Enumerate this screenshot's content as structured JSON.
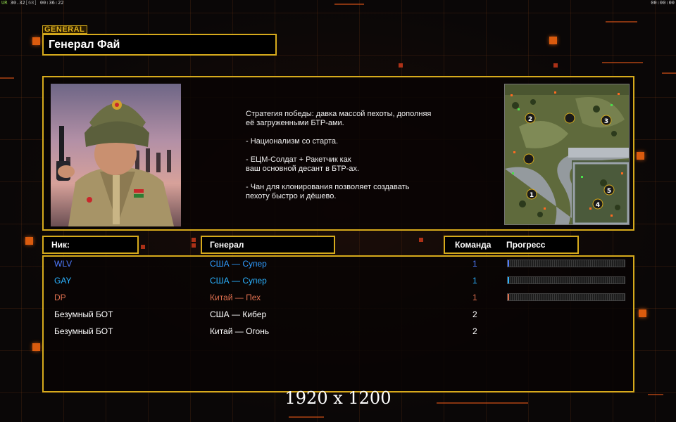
{
  "status": {
    "left_prefix": "UR",
    "left_value": "30.32",
    "left_mid": "[68]",
    "left_time": "00:36:22",
    "right_time": "00:00:00"
  },
  "general": {
    "tag": "GENERAL",
    "name": "Генерал Фай"
  },
  "description": [
    "Стратегия победы: давка массой пехоты, дополняя\n её загруженными БТР-ами.",
    "- Национализм со старта.",
    "- ЕЦМ-Солдат + Ракетчик как\nваш основной десант в БТР-ах.",
    "- Чан для клонирования позволяет создавать\n пехоту быстро и дёшево."
  ],
  "minimap": {
    "positions": [
      "1",
      "2",
      "3",
      "4",
      "5"
    ]
  },
  "headers": {
    "nick": "Ник:",
    "general": "Генерал",
    "team": "Команда",
    "progress": "Прогресс"
  },
  "players": [
    {
      "nick": "WLV",
      "general": "США — Супер",
      "team": "1",
      "color": "#4f7bff",
      "gen_color": "#2f9cff",
      "team_color": "#4f7bff",
      "progress": 0.01,
      "show_progress": true
    },
    {
      "nick": "GAY",
      "general": "США — Супер",
      "team": "1",
      "color": "#2bb2ff",
      "gen_color": "#2bb2ff",
      "team_color": "#2bb2ff",
      "progress": 0.01,
      "show_progress": true
    },
    {
      "nick": "DP",
      "general": "Китай — Пех",
      "team": "1",
      "color": "#e0704f",
      "gen_color": "#e0704f",
      "team_color": "#e0704f",
      "progress": 0.01,
      "show_progress": true
    },
    {
      "nick": "Безумный БОТ",
      "general": "США — Кибер",
      "team": "2",
      "color": "#ffffff",
      "gen_color": "#ffffff",
      "team_color": "#ffffff",
      "progress": 0,
      "show_progress": false
    },
    {
      "nick": "Безумный БОТ",
      "general": "Китай — Огонь",
      "team": "2",
      "color": "#ffffff",
      "gen_color": "#ffffff",
      "team_color": "#ffffff",
      "progress": 0,
      "show_progress": false
    }
  ],
  "watermark": "1920 x 1200",
  "colors": {
    "frame": "#d6aa1c",
    "accent": "#ff6a10"
  }
}
